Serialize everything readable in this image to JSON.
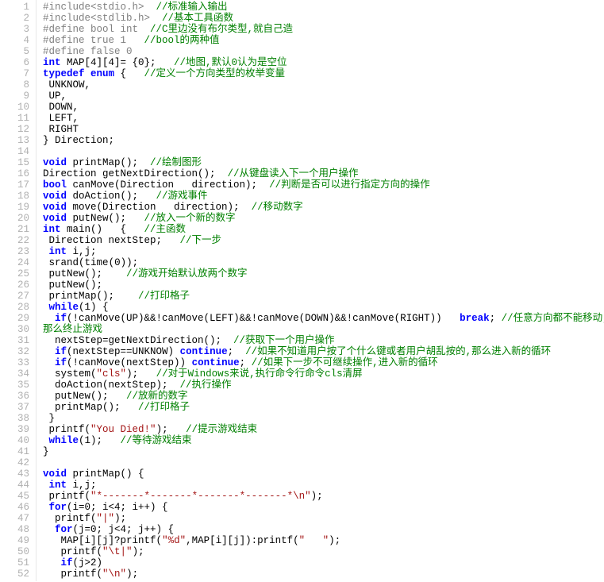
{
  "lines": [
    {
      "n": 1,
      "frags": [
        {
          "c": "pp",
          "t": "#include<stdio.h>  "
        },
        {
          "c": "cm",
          "t": "//标准输入输出"
        }
      ]
    },
    {
      "n": 2,
      "frags": [
        {
          "c": "pp",
          "t": "#include<stdlib.h>  "
        },
        {
          "c": "cm",
          "t": "//基本工具函数"
        }
      ]
    },
    {
      "n": 3,
      "frags": [
        {
          "c": "pp",
          "t": "#define bool int  "
        },
        {
          "c": "cm",
          "t": "//C里边没有布尔类型,就自己造"
        }
      ]
    },
    {
      "n": 4,
      "frags": [
        {
          "c": "pp",
          "t": "#define true 1   "
        },
        {
          "c": "cm",
          "t": "//bool的两种值"
        }
      ]
    },
    {
      "n": 5,
      "frags": [
        {
          "c": "pp",
          "t": "#define false 0"
        }
      ]
    },
    {
      "n": 6,
      "frags": [
        {
          "c": "kw",
          "t": "int"
        },
        {
          "c": "id",
          "t": " MAP[4][4]= {0};   "
        },
        {
          "c": "cm",
          "t": "//地图,默认0认为是空位"
        }
      ]
    },
    {
      "n": 7,
      "frags": [
        {
          "c": "kw",
          "t": "typedef enum"
        },
        {
          "c": "id",
          "t": " {   "
        },
        {
          "c": "cm",
          "t": "//定义一个方向类型的枚举变量"
        }
      ]
    },
    {
      "n": 8,
      "frags": [
        {
          "c": "id",
          "t": " UNKNOW,"
        }
      ]
    },
    {
      "n": 9,
      "frags": [
        {
          "c": "id",
          "t": " UP,"
        }
      ]
    },
    {
      "n": 10,
      "frags": [
        {
          "c": "id",
          "t": " DOWN,"
        }
      ]
    },
    {
      "n": 11,
      "frags": [
        {
          "c": "id",
          "t": " LEFT,"
        }
      ]
    },
    {
      "n": 12,
      "frags": [
        {
          "c": "id",
          "t": " RIGHT"
        }
      ]
    },
    {
      "n": 13,
      "frags": [
        {
          "c": "id",
          "t": "} Direction;"
        }
      ]
    },
    {
      "n": 14,
      "frags": [
        {
          "c": "id",
          "t": ""
        }
      ]
    },
    {
      "n": 15,
      "frags": [
        {
          "c": "kw",
          "t": "void"
        },
        {
          "c": "id",
          "t": " printMap();  "
        },
        {
          "c": "cm",
          "t": "//绘制图形"
        }
      ]
    },
    {
      "n": 16,
      "frags": [
        {
          "c": "id",
          "t": "Direction getNextDirection();  "
        },
        {
          "c": "cm",
          "t": "//从键盘读入下一个用户操作"
        }
      ]
    },
    {
      "n": 17,
      "frags": [
        {
          "c": "kw",
          "t": "bool"
        },
        {
          "c": "id",
          "t": " canMove(Direction   direction);  "
        },
        {
          "c": "cm",
          "t": "//判断是否可以进行指定方向的操作"
        }
      ]
    },
    {
      "n": 18,
      "frags": [
        {
          "c": "kw",
          "t": "void"
        },
        {
          "c": "id",
          "t": " doAction();   "
        },
        {
          "c": "cm",
          "t": "//游戏事件"
        }
      ]
    },
    {
      "n": 19,
      "frags": [
        {
          "c": "kw",
          "t": "void"
        },
        {
          "c": "id",
          "t": " move(Direction   direction);  "
        },
        {
          "c": "cm",
          "t": "//移动数字"
        }
      ]
    },
    {
      "n": 20,
      "frags": [
        {
          "c": "kw",
          "t": "void"
        },
        {
          "c": "id",
          "t": " putNew();   "
        },
        {
          "c": "cm",
          "t": "//放入一个新的数字"
        }
      ]
    },
    {
      "n": 21,
      "frags": [
        {
          "c": "kw",
          "t": "int"
        },
        {
          "c": "id",
          "t": " main()   {   "
        },
        {
          "c": "cm",
          "t": "//主函数"
        }
      ]
    },
    {
      "n": 22,
      "frags": [
        {
          "c": "id",
          "t": " Direction nextStep;   "
        },
        {
          "c": "cm",
          "t": "//下一步"
        }
      ]
    },
    {
      "n": 23,
      "frags": [
        {
          "c": "id",
          "t": " "
        },
        {
          "c": "kw",
          "t": "int"
        },
        {
          "c": "id",
          "t": " i,j;"
        }
      ]
    },
    {
      "n": 24,
      "frags": [
        {
          "c": "id",
          "t": " "
        },
        {
          "c": "fn",
          "t": "srand"
        },
        {
          "c": "id",
          "t": "("
        },
        {
          "c": "fn",
          "t": "time"
        },
        {
          "c": "id",
          "t": "(0));"
        }
      ]
    },
    {
      "n": 25,
      "frags": [
        {
          "c": "id",
          "t": " putNew();    "
        },
        {
          "c": "cm",
          "t": "//游戏开始默认放两个数字"
        }
      ]
    },
    {
      "n": 26,
      "frags": [
        {
          "c": "id",
          "t": " putNew();"
        }
      ]
    },
    {
      "n": 27,
      "frags": [
        {
          "c": "id",
          "t": " printMap();    "
        },
        {
          "c": "cm",
          "t": "//打印格子"
        }
      ]
    },
    {
      "n": 28,
      "frags": [
        {
          "c": "id",
          "t": " "
        },
        {
          "c": "kw",
          "t": "while"
        },
        {
          "c": "id",
          "t": "(1) {"
        }
      ]
    },
    {
      "n": 29,
      "frags": [
        {
          "c": "id",
          "t": "  "
        },
        {
          "c": "kw",
          "t": "if"
        },
        {
          "c": "id",
          "t": "(!canMove(UP)&&!canMove(LEFT)&&!canMove(DOWN)&&!canMove(RIGHT))   "
        },
        {
          "c": "kw",
          "t": "break"
        },
        {
          "c": "id",
          "t": "; "
        },
        {
          "c": "cm",
          "t": "//任意方向都不能移动,"
        }
      ]
    },
    {
      "n": 30,
      "frags": [
        {
          "c": "cm",
          "t": "那么终止游戏"
        }
      ]
    },
    {
      "n": 31,
      "frags": [
        {
          "c": "id",
          "t": "  nextStep=getNextDirection();  "
        },
        {
          "c": "cm",
          "t": "//获取下一个用户操作"
        }
      ]
    },
    {
      "n": 32,
      "frags": [
        {
          "c": "id",
          "t": "  "
        },
        {
          "c": "kw",
          "t": "if"
        },
        {
          "c": "id",
          "t": "(nextStep==UNKNOW) "
        },
        {
          "c": "kw",
          "t": "continue"
        },
        {
          "c": "id",
          "t": ";  "
        },
        {
          "c": "cm",
          "t": "//如果不知道用户按了个什么键或者用户胡乱按的,那么进入新的循环"
        }
      ]
    },
    {
      "n": 33,
      "frags": [
        {
          "c": "id",
          "t": "  "
        },
        {
          "c": "kw",
          "t": "if"
        },
        {
          "c": "id",
          "t": "(!canMove(nextStep)) "
        },
        {
          "c": "kw",
          "t": "continue"
        },
        {
          "c": "id",
          "t": "; "
        },
        {
          "c": "cm",
          "t": "//如果下一步不可继续操作,进入新的循环"
        }
      ]
    },
    {
      "n": 34,
      "frags": [
        {
          "c": "id",
          "t": "  "
        },
        {
          "c": "fn",
          "t": "system"
        },
        {
          "c": "id",
          "t": "("
        },
        {
          "c": "st",
          "t": "\"cls\""
        },
        {
          "c": "id",
          "t": ");   "
        },
        {
          "c": "cm",
          "t": "//对于Windows来说,执行命令行命令cls清屏"
        }
      ]
    },
    {
      "n": 35,
      "frags": [
        {
          "c": "id",
          "t": "  doAction(nextStep);  "
        },
        {
          "c": "cm",
          "t": "//执行操作"
        }
      ]
    },
    {
      "n": 36,
      "frags": [
        {
          "c": "id",
          "t": "  putNew();   "
        },
        {
          "c": "cm",
          "t": "//放新的数字"
        }
      ]
    },
    {
      "n": 37,
      "frags": [
        {
          "c": "id",
          "t": "  printMap();   "
        },
        {
          "c": "cm",
          "t": "//打印格子"
        }
      ]
    },
    {
      "n": 38,
      "frags": [
        {
          "c": "id",
          "t": " }"
        }
      ]
    },
    {
      "n": 39,
      "frags": [
        {
          "c": "id",
          "t": " "
        },
        {
          "c": "fn",
          "t": "printf"
        },
        {
          "c": "id",
          "t": "("
        },
        {
          "c": "st",
          "t": "\"You Died!\""
        },
        {
          "c": "id",
          "t": ");   "
        },
        {
          "c": "cm",
          "t": "//提示游戏结束"
        }
      ]
    },
    {
      "n": 40,
      "frags": [
        {
          "c": "id",
          "t": " "
        },
        {
          "c": "kw",
          "t": "while"
        },
        {
          "c": "id",
          "t": "(1);   "
        },
        {
          "c": "cm",
          "t": "//等待游戏结束"
        }
      ]
    },
    {
      "n": 41,
      "frags": [
        {
          "c": "id",
          "t": "}"
        }
      ]
    },
    {
      "n": 42,
      "frags": [
        {
          "c": "id",
          "t": ""
        }
      ]
    },
    {
      "n": 43,
      "frags": [
        {
          "c": "kw",
          "t": "void"
        },
        {
          "c": "id",
          "t": " printMap() {"
        }
      ]
    },
    {
      "n": 44,
      "frags": [
        {
          "c": "id",
          "t": " "
        },
        {
          "c": "kw",
          "t": "int"
        },
        {
          "c": "id",
          "t": " i,j;"
        }
      ]
    },
    {
      "n": 45,
      "frags": [
        {
          "c": "id",
          "t": " "
        },
        {
          "c": "fn",
          "t": "printf"
        },
        {
          "c": "id",
          "t": "("
        },
        {
          "c": "st",
          "t": "\"*-------*-------*-------*-------*\\n\""
        },
        {
          "c": "id",
          "t": ");"
        }
      ]
    },
    {
      "n": 46,
      "frags": [
        {
          "c": "id",
          "t": " "
        },
        {
          "c": "kw",
          "t": "for"
        },
        {
          "c": "id",
          "t": "(i=0; i<4; i++) {"
        }
      ]
    },
    {
      "n": 47,
      "frags": [
        {
          "c": "id",
          "t": "  "
        },
        {
          "c": "fn",
          "t": "printf"
        },
        {
          "c": "id",
          "t": "("
        },
        {
          "c": "st",
          "t": "\"|\""
        },
        {
          "c": "id",
          "t": ");"
        }
      ]
    },
    {
      "n": 48,
      "frags": [
        {
          "c": "id",
          "t": "  "
        },
        {
          "c": "kw",
          "t": "for"
        },
        {
          "c": "id",
          "t": "(j=0; j<4; j++) {"
        }
      ]
    },
    {
      "n": 49,
      "frags": [
        {
          "c": "id",
          "t": "   MAP[i][j]?"
        },
        {
          "c": "fn",
          "t": "printf"
        },
        {
          "c": "id",
          "t": "("
        },
        {
          "c": "st",
          "t": "\"%d\""
        },
        {
          "c": "id",
          "t": ",MAP[i][j]):"
        },
        {
          "c": "fn",
          "t": "printf"
        },
        {
          "c": "id",
          "t": "("
        },
        {
          "c": "st",
          "t": "\"   \""
        },
        {
          "c": "id",
          "t": ");"
        }
      ]
    },
    {
      "n": 50,
      "frags": [
        {
          "c": "id",
          "t": "   "
        },
        {
          "c": "fn",
          "t": "printf"
        },
        {
          "c": "id",
          "t": "("
        },
        {
          "c": "st",
          "t": "\"\\t|\""
        },
        {
          "c": "id",
          "t": ");"
        }
      ]
    },
    {
      "n": 51,
      "frags": [
        {
          "c": "id",
          "t": "   "
        },
        {
          "c": "kw",
          "t": "if"
        },
        {
          "c": "id",
          "t": "(j>2)"
        }
      ]
    },
    {
      "n": 52,
      "frags": [
        {
          "c": "id",
          "t": "   "
        },
        {
          "c": "fn",
          "t": "printf"
        },
        {
          "c": "id",
          "t": "("
        },
        {
          "c": "st",
          "t": "\"\\n\""
        },
        {
          "c": "id",
          "t": ");"
        }
      ]
    }
  ]
}
